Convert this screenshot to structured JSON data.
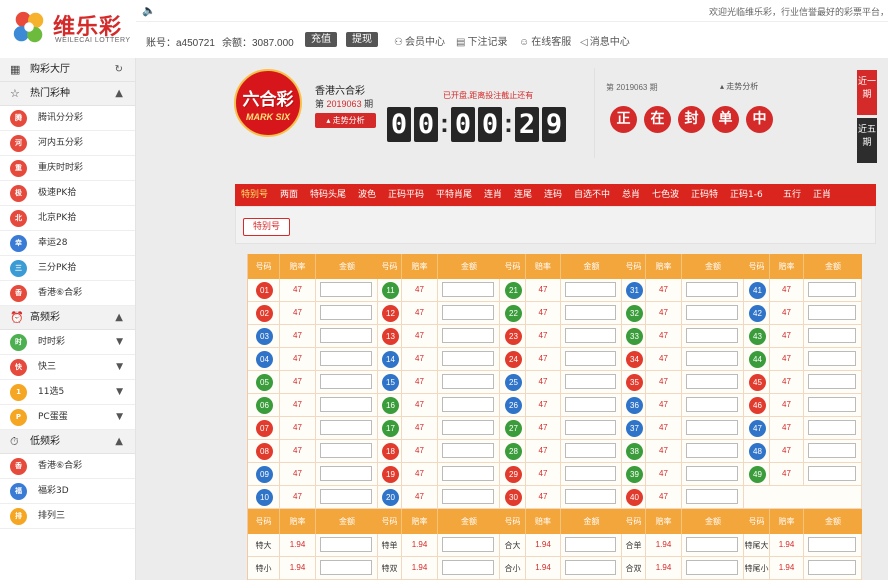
{
  "logo": {
    "name": "维乐彩",
    "sub": "WEILECAI LOTTERY"
  },
  "notice": {
    "text": "欢迎光临维乐彩，行业信誉最好的彩票平台，玩彩票"
  },
  "account": {
    "account_label": "账号：a450721",
    "balance_label": "余额：3087.000",
    "recharge": "充值",
    "withdraw": "提现",
    "nav": [
      {
        "icon": "user-icon",
        "label": "会员中心"
      },
      {
        "icon": "document-icon",
        "label": "下注记录"
      },
      {
        "icon": "chat-icon",
        "label": "在线客服"
      },
      {
        "icon": "speaker-icon",
        "label": "消息中心"
      }
    ]
  },
  "sidebar": {
    "hall": "购彩大厅",
    "groups": [
      {
        "title": "热门彩种",
        "items": [
          {
            "label": "腾讯分分彩",
            "color": "#e64a3c"
          },
          {
            "label": "河内五分彩",
            "color": "#e64a3c"
          },
          {
            "label": "重庆时时彩",
            "color": "#e64a3c"
          },
          {
            "label": "极速PK拾",
            "color": "#e64a3c"
          },
          {
            "label": "北京PK拾",
            "color": "#e64a3c"
          },
          {
            "label": "幸运28",
            "color": "#3a7bd5"
          },
          {
            "label": "三分PK拾",
            "color": "#3a9bd5"
          },
          {
            "label": "香港⑥合彩",
            "color": "#e64a3c"
          }
        ]
      },
      {
        "title": "高频彩",
        "items": [
          {
            "label": "时时彩",
            "color": "#4caf50"
          },
          {
            "label": "快三",
            "color": "#e64a3c"
          },
          {
            "label": "11选5",
            "color": "#f5a623"
          },
          {
            "label": "PC蛋蛋",
            "color": "#f5a623"
          }
        ]
      },
      {
        "title": "低频彩",
        "items": [
          {
            "label": "香港⑥合彩",
            "color": "#e64a3c"
          },
          {
            "label": "福彩3D",
            "color": "#3a7bd5"
          },
          {
            "label": "排列三",
            "color": "#f5a623"
          }
        ]
      }
    ]
  },
  "draw": {
    "logo_cn": "六合彩",
    "logo_en": "MARK SIX",
    "title": "香港六合彩",
    "period_prefix": "第",
    "period": "2019063",
    "period_suffix": "期",
    "trend_button": "走势分析",
    "status": "已开盘,距离投注截止还有",
    "countdown": [
      "0",
      "0",
      "0",
      "0",
      "2",
      "9"
    ],
    "result_period": "第 2019063 期",
    "result_trend": "走势分析",
    "result_text": [
      "正",
      "在",
      "封",
      "单",
      "中"
    ],
    "tab_recent": "近一期",
    "tab_five": "近五期"
  },
  "tabs": [
    "特别号",
    "两面",
    "特码头尾",
    "波色",
    "正码平码",
    "平特肖尾",
    "连肖",
    "连尾",
    "连码",
    "自选不中",
    "总肖",
    "七色波",
    "正码特",
    "正码1-6",
    "五行",
    "正肖"
  ],
  "subtab": "特别号",
  "table": {
    "headers": [
      "号码",
      "赔率",
      "金额"
    ],
    "odds": "47",
    "numbers": [
      1,
      2,
      3,
      4,
      5,
      6,
      7,
      8,
      9,
      10,
      11,
      12,
      13,
      14,
      15,
      16,
      17,
      18,
      19,
      20,
      21,
      22,
      23,
      24,
      25,
      26,
      27,
      28,
      29,
      30,
      31,
      32,
      33,
      34,
      35,
      36,
      37,
      38,
      39,
      40,
      41,
      42,
      43,
      44,
      45,
      46,
      47,
      48,
      49
    ],
    "red": [
      1,
      2,
      7,
      8,
      12,
      13,
      18,
      19,
      23,
      24,
      29,
      30,
      34,
      35,
      40,
      45,
      46
    ],
    "blue": [
      3,
      4,
      9,
      10,
      14,
      15,
      20,
      25,
      26,
      31,
      36,
      37,
      41,
      42,
      47,
      48
    ],
    "green": [
      5,
      6,
      11,
      16,
      17,
      21,
      22,
      27,
      28,
      32,
      33,
      38,
      39,
      43,
      44,
      49
    ],
    "overlay_label": "连肖",
    "overlay_label2": "赔率",
    "side_headers": [
      "号码",
      "赔率",
      "金额"
    ],
    "side_rows": [
      [
        {
          "label": "特大",
          "odds": "1.94"
        },
        {
          "label": "特单",
          "odds": "1.94"
        },
        {
          "label": "合大",
          "odds": "1.94"
        },
        {
          "label": "合单",
          "odds": "1.94"
        },
        {
          "label": "特尾大",
          "odds": "1.94"
        }
      ],
      [
        {
          "label": "特小",
          "odds": "1.94"
        },
        {
          "label": "特双",
          "odds": "1.94"
        },
        {
          "label": "合小",
          "odds": "1.94"
        },
        {
          "label": "合双",
          "odds": "1.94"
        },
        {
          "label": "特尾小",
          "odds": "1.94"
        }
      ]
    ]
  },
  "colors": {
    "red": "#e13b2e",
    "blue": "#2f74c8",
    "green": "#3a9c3a",
    "accent": "#d9251d",
    "header": "#f3a63c"
  }
}
